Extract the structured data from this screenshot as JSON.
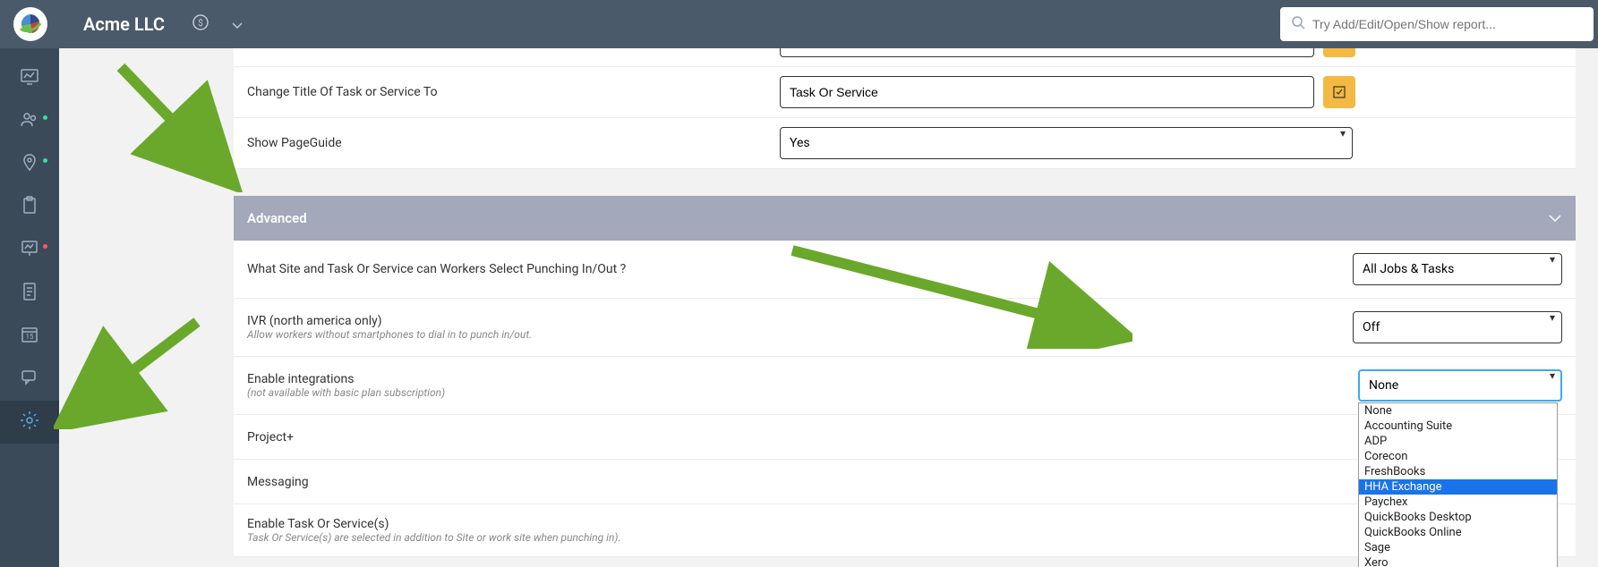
{
  "header": {
    "appTitle": "Acme LLC",
    "searchPlaceholder": "Try Add/Edit/Open/Show report..."
  },
  "rows": {
    "changeTitle": {
      "label": "Change Title Of Task or Service To",
      "value": "Task Or Service"
    },
    "showPageGuide": {
      "label": "Show PageGuide",
      "value": "Yes"
    }
  },
  "advanced": {
    "header": "Advanced",
    "siteTask": {
      "label": "What Site and Task Or Service can Workers Select Punching In/Out ?",
      "value": "All Jobs & Tasks"
    },
    "ivr": {
      "label": "IVR (north america only)",
      "sub": "Allow workers without smartphones to dial in to punch in/out.",
      "value": "Off"
    },
    "integrations": {
      "label": "Enable integrations",
      "sub": "(not available with basic plan subscription)",
      "value": "None"
    },
    "projectPlus": {
      "label": "Project+"
    },
    "messaging": {
      "label": "Messaging"
    },
    "enableTask": {
      "label": "Enable Task Or Service(s)",
      "sub": "Task Or Service(s) are selected in addition to Site or work site when punching in)."
    }
  },
  "dropdown": {
    "options": [
      {
        "label": "None"
      },
      {
        "label": "Accounting Suite"
      },
      {
        "label": "ADP"
      },
      {
        "label": "Corecon"
      },
      {
        "label": "FreshBooks"
      },
      {
        "label": "HHA Exchange"
      },
      {
        "label": "Paychex"
      },
      {
        "label": "QuickBooks Desktop"
      },
      {
        "label": "QuickBooks Online"
      },
      {
        "label": "Sage"
      },
      {
        "label": "Xero"
      }
    ],
    "highlightedIndex": 5
  }
}
